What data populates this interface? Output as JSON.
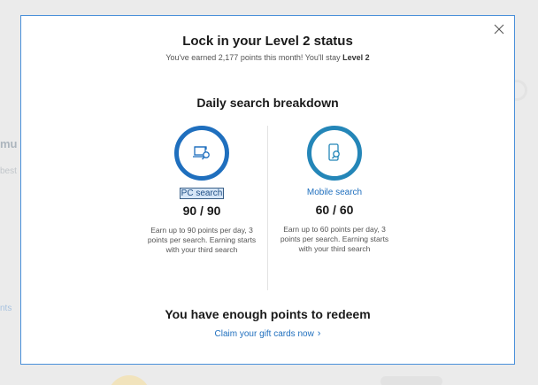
{
  "background": {
    "fragment_1": "mu",
    "fragment_2": "best",
    "fragment_3": "nts"
  },
  "modal": {
    "close_icon": "close-icon",
    "title": "Lock in your Level 2 status",
    "subtitle_prefix": "You've earned 2,177 points this month! You'll stay ",
    "subtitle_level": "Level 2",
    "section_title": "Daily search breakdown",
    "pc": {
      "icon": "laptop-search-icon",
      "label": "PC search",
      "value": "90 / 90",
      "description": "Earn up to 90 points per day, 3 points per search. Earning starts with your third search"
    },
    "mobile": {
      "icon": "phone-search-icon",
      "label": "Mobile search",
      "value": "60 / 60",
      "description": "Earn up to 60 points per day, 3 points per search. Earning starts with your third search"
    },
    "redeem_title": "You have enough points to redeem",
    "redeem_link": "Claim your gift cards now",
    "redeem_chevron": "›"
  },
  "colors": {
    "accent": "#1f6fbe",
    "modal_border": "#4a90d9",
    "pc_ring": "#1f6fbe",
    "mobile_ring": "#2486b8"
  }
}
